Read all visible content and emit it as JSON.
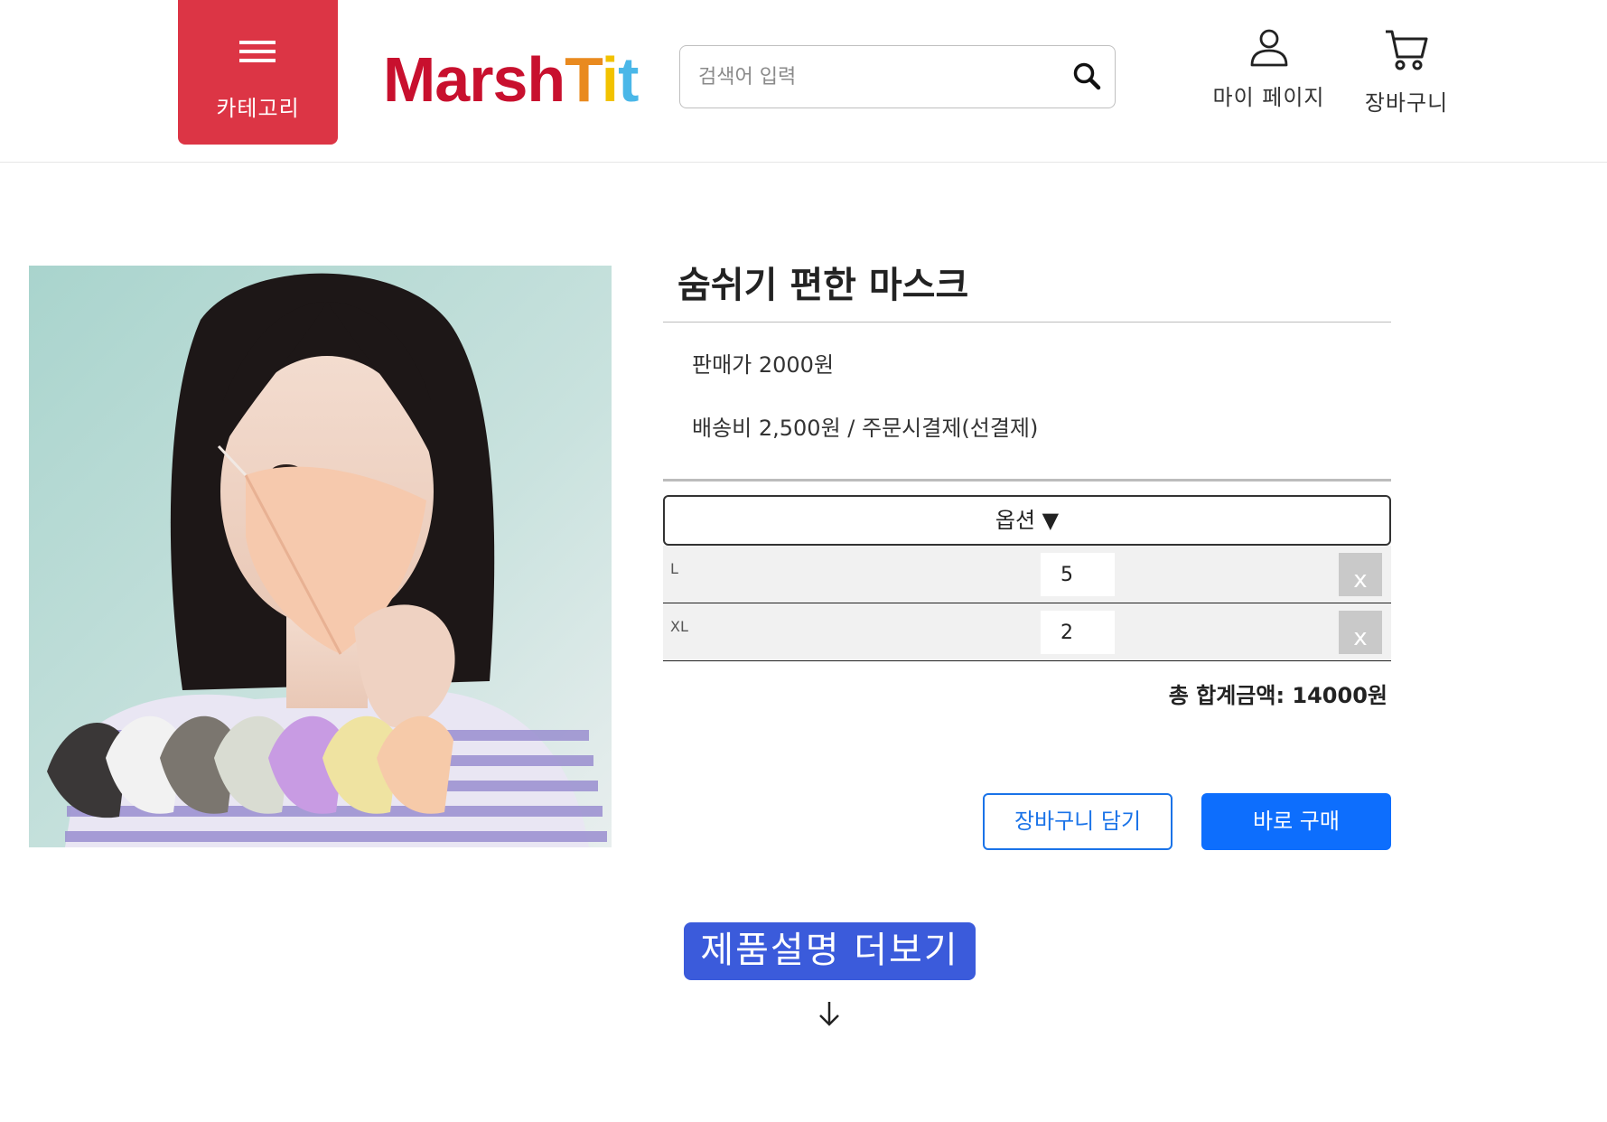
{
  "header": {
    "category_label": "카테고리",
    "logo": {
      "part1": "Marsh",
      "part2": "T",
      "part3": "i",
      "part4": "t"
    },
    "search_placeholder": "검색어 입력",
    "mypage_label": "마이 페이지",
    "cart_label": "장바구니"
  },
  "icons": {
    "menu": "menu-icon",
    "search": "search-icon",
    "user": "user-icon",
    "cart": "cart-icon",
    "arrow": "arrow-down-icon"
  },
  "colors": {
    "category_bg": "#dc3545",
    "logo_red": "#c8102e",
    "logo_orange": "#e98a1f",
    "logo_yellow": "#f2c200",
    "logo_blue": "#4ab7e8",
    "primary": "#0d6efd",
    "more_button": "#3b5bdb"
  },
  "product": {
    "title": "숨쉬기 편한 마스크",
    "price_text": "판매가 2000원",
    "shipping_text": "배송비 2,500원 / 주문시결제(선결제)",
    "option_label": "옵션 ▼",
    "options": [
      {
        "name": "L",
        "quantity": "5",
        "remove_label": "x"
      },
      {
        "name": "XL",
        "quantity": "2",
        "remove_label": "x"
      }
    ],
    "total_text": "총 합계금액: 14000원",
    "add_to_cart_label": "장바구니 담기",
    "buy_now_label": "바로 구매"
  },
  "more": {
    "label": "제품설명 더보기"
  }
}
